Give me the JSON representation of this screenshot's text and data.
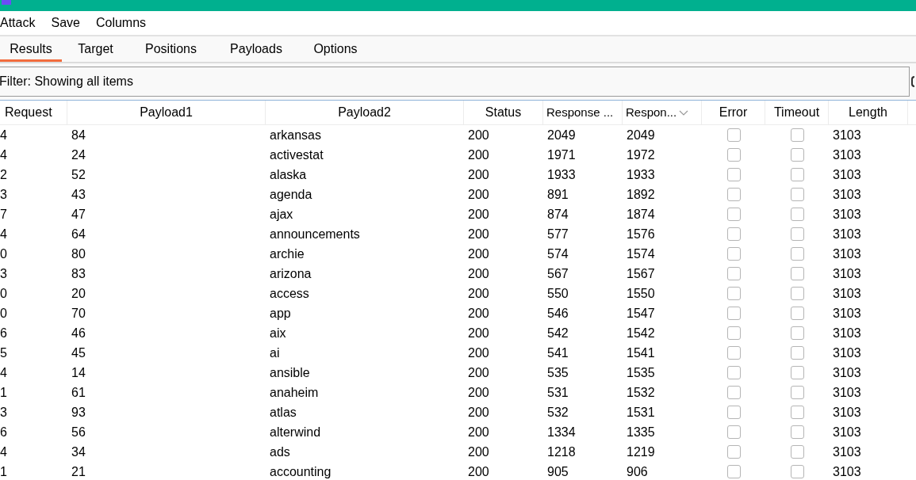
{
  "menu": [
    "Attack",
    "Save",
    "Columns"
  ],
  "tabs": [
    {
      "label": "Results",
      "selected": true
    },
    {
      "label": "Target",
      "selected": false
    },
    {
      "label": "Positions",
      "selected": false
    },
    {
      "label": "Payloads",
      "selected": false
    },
    {
      "label": "Options",
      "selected": false
    }
  ],
  "filter": {
    "value": "Filter: Showing all items"
  },
  "table": {
    "columns": [
      {
        "label": "Request",
        "sorted": false
      },
      {
        "label": "Payload1",
        "sorted": false
      },
      {
        "label": "Payload2",
        "sorted": false
      },
      {
        "label": "Status",
        "sorted": false
      },
      {
        "label": "Response ...",
        "sorted": false
      },
      {
        "label": "Respon...",
        "sorted": true
      },
      {
        "label": "Error",
        "sorted": false
      },
      {
        "label": "Timeout",
        "sorted": false
      },
      {
        "label": "Length",
        "sorted": false
      }
    ],
    "rows": [
      {
        "request": "4",
        "payload1": "84",
        "payload2": "arkansas",
        "status": "200",
        "response_1": "2049",
        "response_2": "2049",
        "error": false,
        "timeout": false,
        "length": "3103"
      },
      {
        "request": "4",
        "payload1": "24",
        "payload2": "activestat",
        "status": "200",
        "response_1": "1971",
        "response_2": "1972",
        "error": false,
        "timeout": false,
        "length": "3103"
      },
      {
        "request": "2",
        "payload1": "52",
        "payload2": "alaska",
        "status": "200",
        "response_1": "1933",
        "response_2": "1933",
        "error": false,
        "timeout": false,
        "length": "3103"
      },
      {
        "request": "3",
        "payload1": "43",
        "payload2": "agenda",
        "status": "200",
        "response_1": "891",
        "response_2": "1892",
        "error": false,
        "timeout": false,
        "length": "3103"
      },
      {
        "request": "7",
        "payload1": "47",
        "payload2": "ajax",
        "status": "200",
        "response_1": "874",
        "response_2": "1874",
        "error": false,
        "timeout": false,
        "length": "3103"
      },
      {
        "request": "4",
        "payload1": "64",
        "payload2": "announcements",
        "status": "200",
        "response_1": "577",
        "response_2": "1576",
        "error": false,
        "timeout": false,
        "length": "3103"
      },
      {
        "request": "0",
        "payload1": "80",
        "payload2": "archie",
        "status": "200",
        "response_1": "574",
        "response_2": "1574",
        "error": false,
        "timeout": false,
        "length": "3103"
      },
      {
        "request": "3",
        "payload1": "83",
        "payload2": "arizona",
        "status": "200",
        "response_1": "567",
        "response_2": "1567",
        "error": false,
        "timeout": false,
        "length": "3103"
      },
      {
        "request": "0",
        "payload1": "20",
        "payload2": "access",
        "status": "200",
        "response_1": "550",
        "response_2": "1550",
        "error": false,
        "timeout": false,
        "length": "3103"
      },
      {
        "request": "0",
        "payload1": "70",
        "payload2": "app",
        "status": "200",
        "response_1": "546",
        "response_2": "1547",
        "error": false,
        "timeout": false,
        "length": "3103"
      },
      {
        "request": "6",
        "payload1": "46",
        "payload2": "aix",
        "status": "200",
        "response_1": "542",
        "response_2": "1542",
        "error": false,
        "timeout": false,
        "length": "3103"
      },
      {
        "request": "5",
        "payload1": "45",
        "payload2": "ai",
        "status": "200",
        "response_1": "541",
        "response_2": "1541",
        "error": false,
        "timeout": false,
        "length": "3103"
      },
      {
        "request": "4",
        "payload1": "14",
        "payload2": "ansible",
        "status": "200",
        "response_1": "535",
        "response_2": "1535",
        "error": false,
        "timeout": false,
        "length": "3103"
      },
      {
        "request": "1",
        "payload1": "61",
        "payload2": "anaheim",
        "status": "200",
        "response_1": "531",
        "response_2": "1532",
        "error": false,
        "timeout": false,
        "length": "3103"
      },
      {
        "request": "3",
        "payload1": "93",
        "payload2": "atlas",
        "status": "200",
        "response_1": "532",
        "response_2": "1531",
        "error": false,
        "timeout": false,
        "length": "3103"
      },
      {
        "request": "6",
        "payload1": "56",
        "payload2": "alterwind",
        "status": "200",
        "response_1": "1334",
        "response_2": "1335",
        "error": false,
        "timeout": false,
        "length": "3103"
      },
      {
        "request": "4",
        "payload1": "34",
        "payload2": "ads",
        "status": "200",
        "response_1": "1218",
        "response_2": "1219",
        "error": false,
        "timeout": false,
        "length": "3103"
      },
      {
        "request": "1",
        "payload1": "21",
        "payload2": "accounting",
        "status": "200",
        "response_1": "905",
        "response_2": "906",
        "error": false,
        "timeout": false,
        "length": "3103"
      }
    ]
  }
}
